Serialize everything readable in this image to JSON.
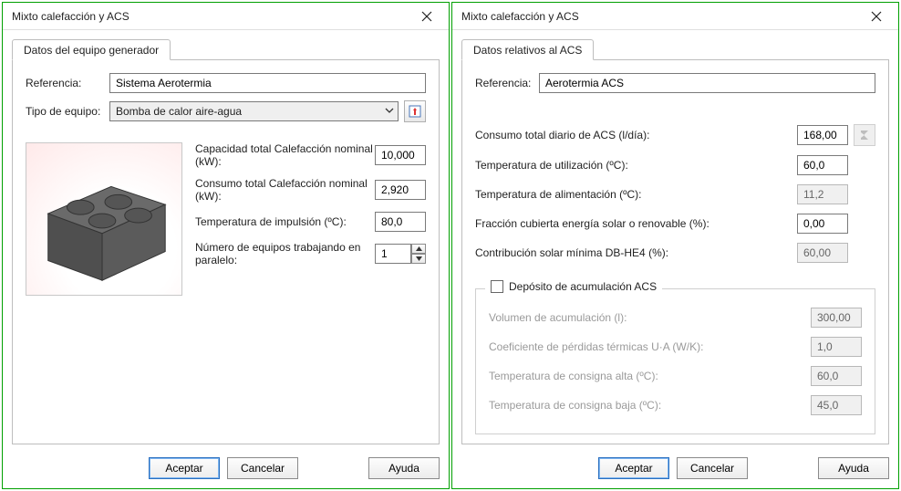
{
  "left": {
    "title": "Mixto calefacción y ACS",
    "tab": "Datos del equipo generador",
    "ref_label": "Referencia:",
    "ref_value": "Sistema Aerotermia",
    "tipo_label": "Tipo de equipo:",
    "tipo_value": "Bomba de calor aire-agua",
    "params": {
      "cap_label": "Capacidad total Calefacción nominal (kW):",
      "cap_value": "10,000",
      "con_label": "Consumo total Calefacción nominal (kW):",
      "con_value": "2,920",
      "temp_label": "Temperatura de impulsión (ºC):",
      "temp_value": "80,0",
      "num_label": "Número de equipos trabajando en paralelo:",
      "num_value": "1"
    },
    "buttons": {
      "accept": "Aceptar",
      "cancel": "Cancelar",
      "help": "Ayuda"
    }
  },
  "right": {
    "title": "Mixto calefacción y ACS",
    "tab": "Datos relativos al ACS",
    "ref_label": "Referencia:",
    "ref_value": "Aerotermia ACS",
    "params": {
      "consumo_label": "Consumo total diario de ACS (l/día):",
      "consumo_value": "168,00",
      "temp_util_label": "Temperatura de utilización (ºC):",
      "temp_util_value": "60,0",
      "temp_alim_label": "Temperatura de alimentación (ºC):",
      "temp_alim_value": "11,2",
      "fraccion_label": "Fracción cubierta energía solar o renovable (%):",
      "fraccion_value": "0,00",
      "contrib_label": "Contribución solar mínima DB-HE4 (%):",
      "contrib_value": "60,00"
    },
    "tank": {
      "legend": "Depósito de acumulación ACS",
      "vol_label": "Volumen de acumulación (l):",
      "vol_value": "300,00",
      "coef_label": "Coeficiente de pérdidas térmicas U·A (W/K):",
      "coef_value": "1,0",
      "tca_label": "Temperatura de consigna alta (ºC):",
      "tca_value": "60,0",
      "tcb_label": "Temperatura de consigna baja (ºC):",
      "tcb_value": "45,0"
    },
    "buttons": {
      "accept": "Aceptar",
      "cancel": "Cancelar",
      "help": "Ayuda"
    }
  }
}
